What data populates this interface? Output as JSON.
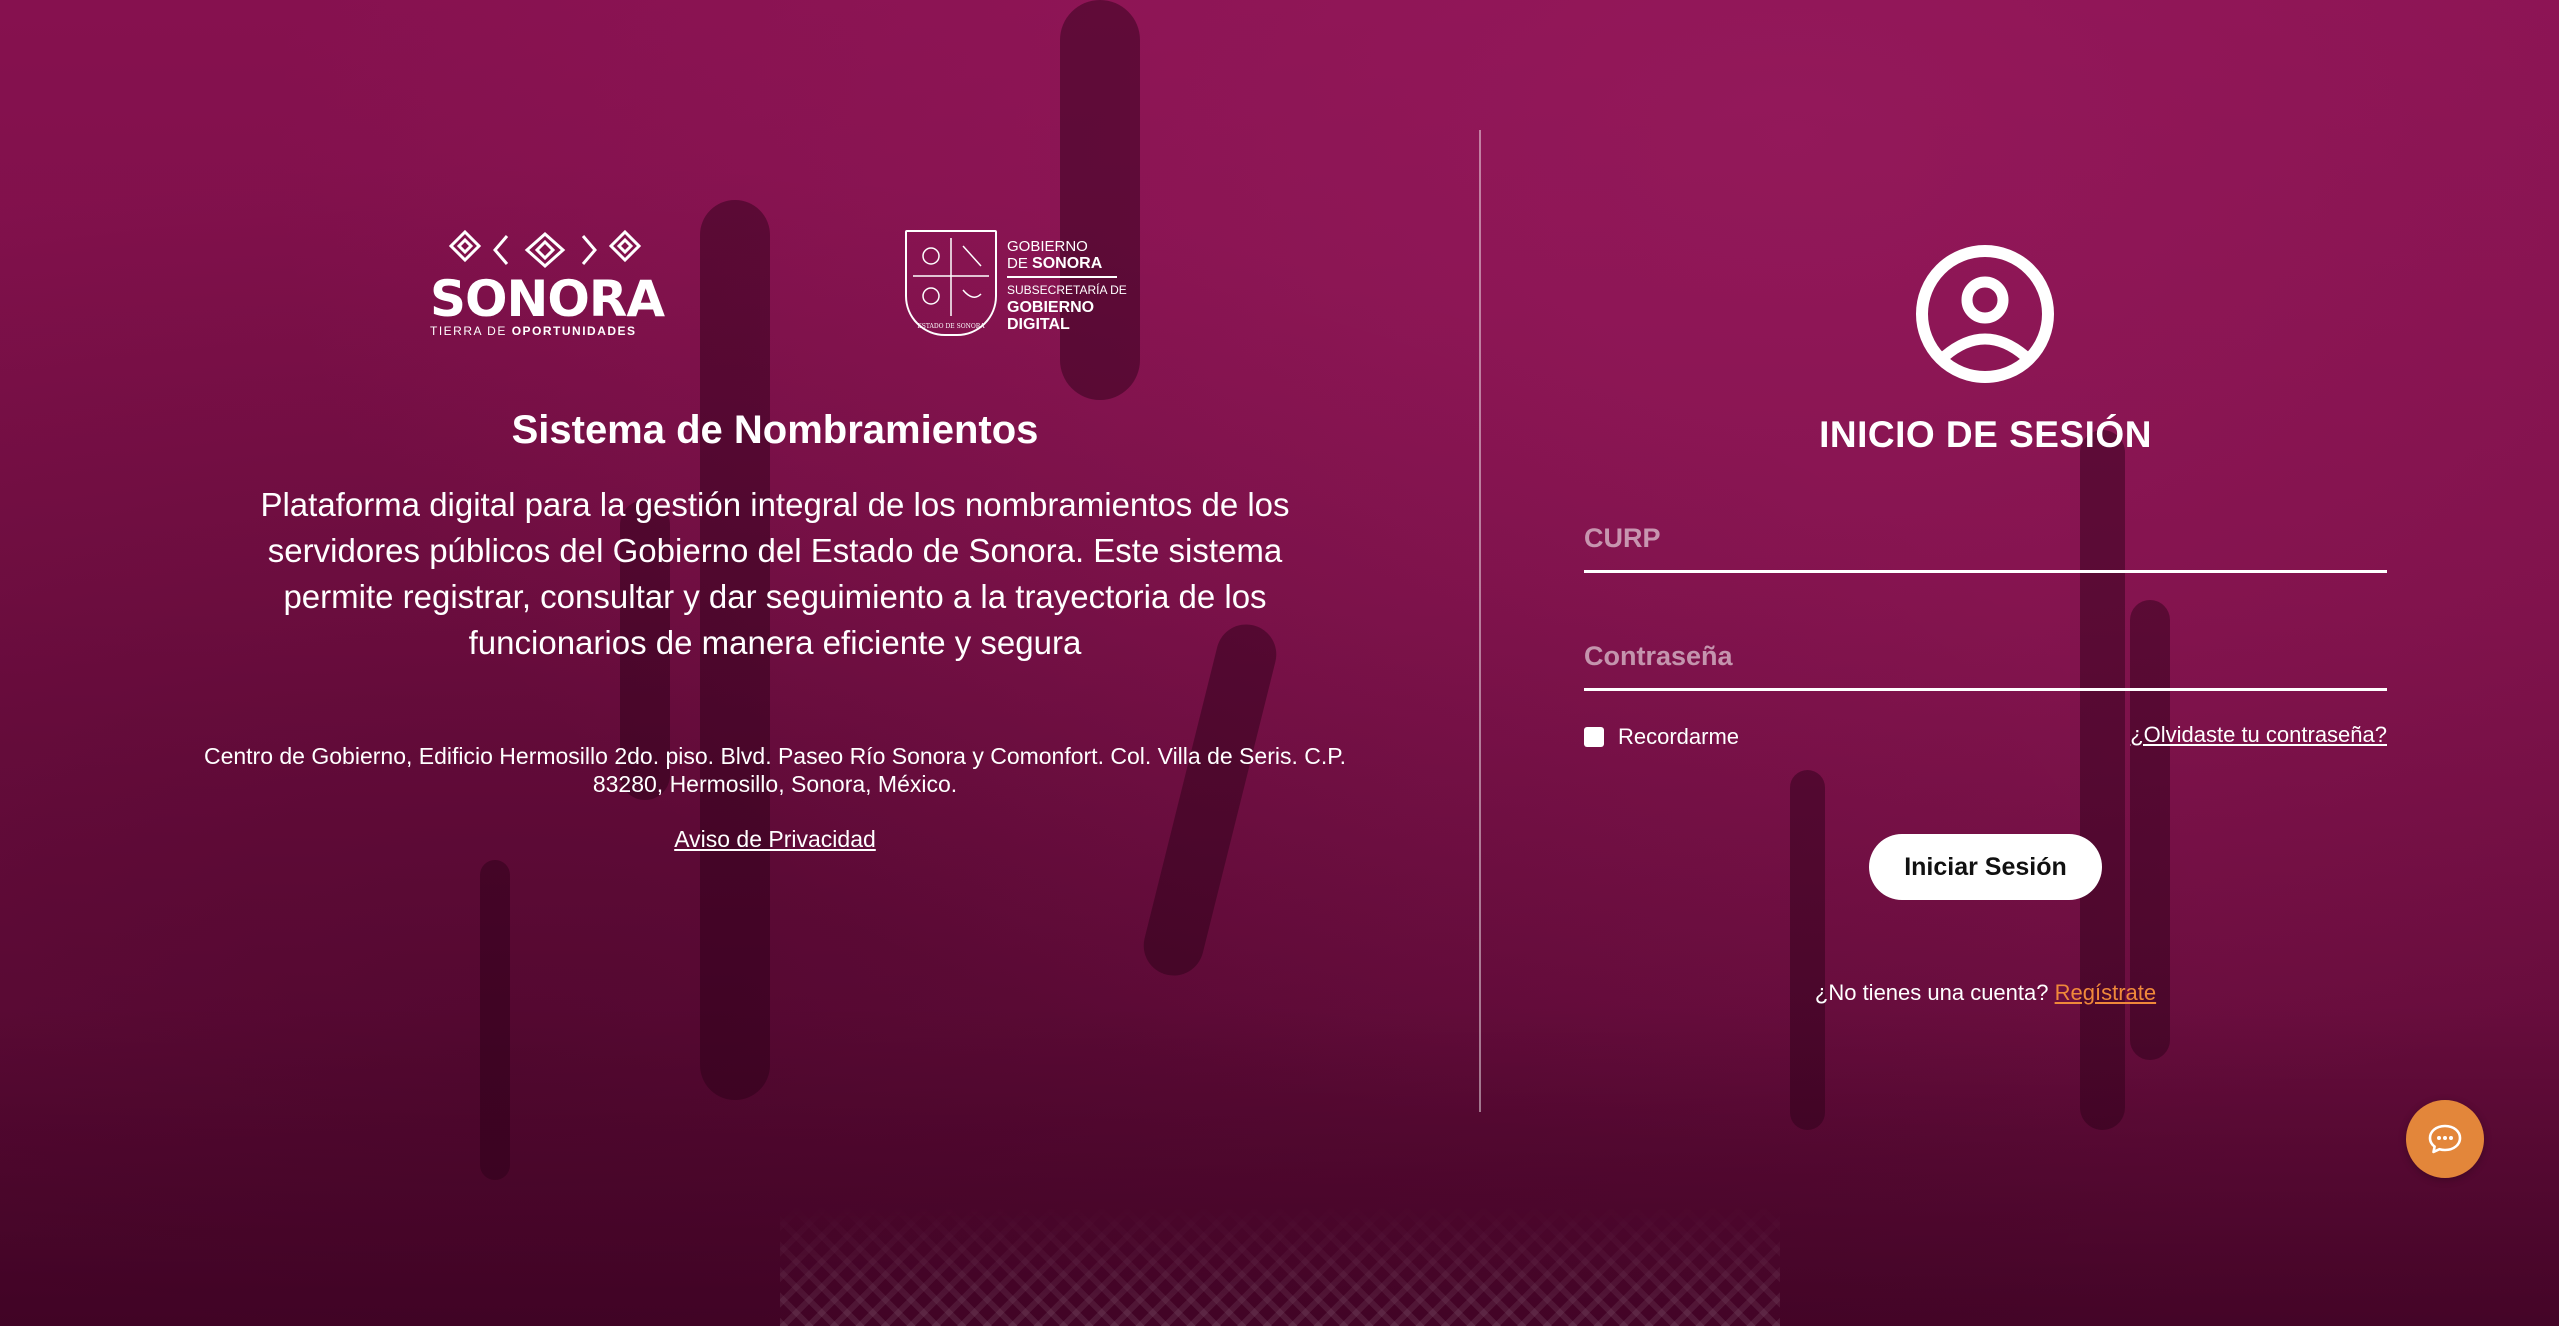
{
  "left": {
    "sonora_logo": {
      "word": "SONORA",
      "tagline_prefix": "TIERRA DE ",
      "tagline_bold": "OPORTUNIDADES"
    },
    "gob_logo": {
      "line1": "GOBIERNO",
      "line2_prefix": "DE ",
      "line2_bold": "SONORA",
      "line3": "SUBSECRETARÍA DE",
      "line4": "GOBIERNO",
      "line5": "DIGITAL",
      "shield_caption": "ESTADO DE SONORA"
    },
    "title": "Sistema de Nombramientos",
    "description": "Plataforma digital para la gestión integral de los nombramientos de los servidores públicos del Gobierno del Estado de Sonora. Este sistema permite registrar, consultar y dar seguimiento a la trayectoria de los funcionarios de manera eficiente y segura",
    "address": "Centro de Gobierno, Edificio Hermosillo 2do. piso. Blvd. Paseo Río Sonora y Comonfort. Col. Villa de Seris. C.P. 83280, Hermosillo, Sonora, México.",
    "privacy_link": "Aviso de Privacidad"
  },
  "login": {
    "title": "INICIO DE SESIÓN",
    "curp_placeholder": "CURP",
    "password_placeholder": "Contraseña",
    "remember_label": "Recordarme",
    "forgot_link": "¿Olvidaste tu contraseña?",
    "submit_label": "Iniciar Sesión",
    "register_prompt": "¿No tienes una cuenta? ",
    "register_link": "Regístrate"
  },
  "colors": {
    "background": "#7a1148",
    "accent": "#e3863a",
    "link_accent": "#f0893a"
  },
  "icons": {
    "avatar": "user-circle-icon",
    "chat": "chat-bubble-icon"
  }
}
